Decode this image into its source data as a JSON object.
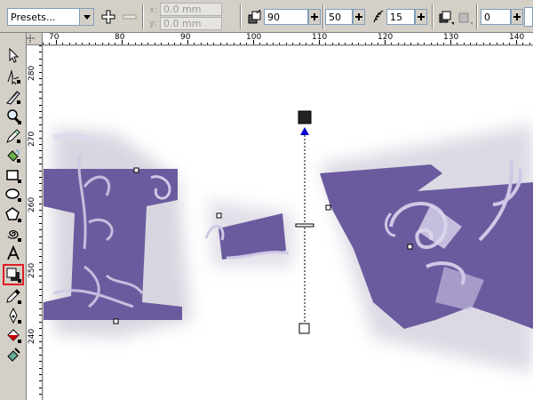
{
  "property_bar": {
    "presets_value": "Presets...",
    "x_label": "x:",
    "y_label": "y:",
    "x_value": "0.0 mm",
    "y_value": "0.0 mm",
    "shadow_angle": "90",
    "shadow_opacity": "50",
    "shadow_feather": "15",
    "shadow_fade": "0"
  },
  "rulers": {
    "horizontal_ticks": [
      "70",
      "80",
      "90",
      "100",
      "110",
      "120",
      "130",
      "140"
    ],
    "vertical_ticks": [
      "280",
      "270",
      "260",
      "250",
      "240"
    ]
  },
  "toolbox": {
    "tools": [
      "pick-tool",
      "shape-tool",
      "knife-tool",
      "zoom-tool",
      "freehand-tool",
      "smart-fill-tool",
      "rectangle-tool",
      "ellipse-tool",
      "polygon-tool",
      "spiral-tool",
      "text-tool",
      "drop-shadow-tool",
      "eyedropper-tool",
      "outline-tool",
      "fill-tool",
      "interactive-fill-tool"
    ],
    "selected_tool": "drop-shadow-tool",
    "highlight_color": "#e21d24"
  },
  "canvas": {
    "text_fill_color": "#6b5b9e",
    "swirl_color": "#c8c0e0",
    "shadow_handle_color": "#0000cc"
  }
}
